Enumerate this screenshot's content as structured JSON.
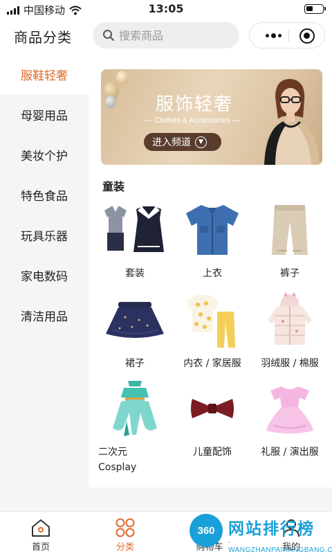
{
  "status_bar": {
    "carrier": "中国移动",
    "time": "13:05"
  },
  "header": {
    "title": "商品分类",
    "search_placeholder": "搜索商品"
  },
  "sidebar": {
    "items": [
      {
        "label": "服鞋轻奢",
        "active": true
      },
      {
        "label": "母婴用品"
      },
      {
        "label": "美妆个护"
      },
      {
        "label": "特色食品"
      },
      {
        "label": "玩具乐器"
      },
      {
        "label": "家电数码"
      },
      {
        "label": "清洁用品"
      }
    ]
  },
  "banner": {
    "title": "服饰轻奢",
    "subtitle": "— Clothes & Accessories —",
    "button_label": "进入频道"
  },
  "section": {
    "title": "童装",
    "products": [
      {
        "name": "套装",
        "icon": "kids-suit-icon"
      },
      {
        "name": "上衣",
        "icon": "shirt-icon"
      },
      {
        "name": "裤子",
        "icon": "pants-icon"
      },
      {
        "name": "裙子",
        "icon": "skirt-icon"
      },
      {
        "name": "内衣 / 家居服",
        "icon": "homewear-icon"
      },
      {
        "name": "羽绒服 / 棉服",
        "icon": "down-jacket-icon"
      },
      {
        "name": "二次元",
        "name_line2": "Cosplay",
        "icon": "cosplay-costume-icon"
      },
      {
        "name": "儿童配饰",
        "icon": "bow-tie-icon"
      },
      {
        "name": "礼服 / 演出服",
        "icon": "dress-icon"
      }
    ]
  },
  "bottom_nav": {
    "items": [
      {
        "label": "首页",
        "icon": "home-icon"
      },
      {
        "label": "分类",
        "icon": "category-grid-icon",
        "active": true
      },
      {
        "label": "购物车",
        "icon": "cart-icon"
      },
      {
        "label": "我的",
        "icon": "user-icon"
      }
    ]
  },
  "watermark": {
    "badge": "360",
    "title": "网站排行榜",
    "url": "-WANGZHANPAIHANGBANG.CN-"
  },
  "colors": {
    "accent": "#e06a2a",
    "search_bg": "#eeeeef",
    "sidebar_bg": "#f5f5f5",
    "watermark": "#1aa0d8"
  }
}
